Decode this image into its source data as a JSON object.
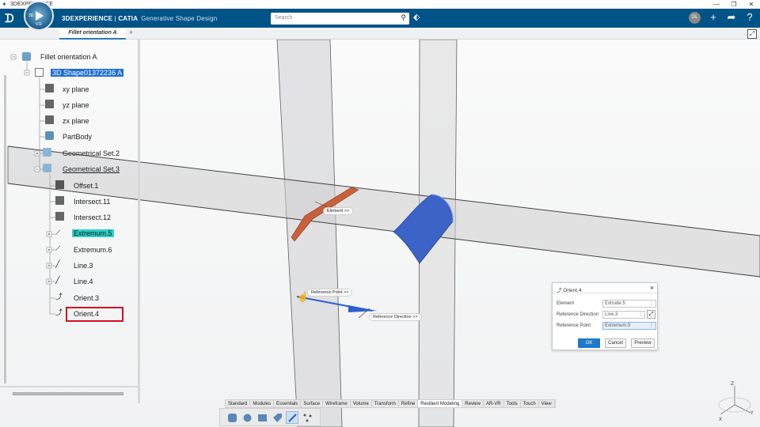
{
  "os_bar": {
    "title": "3DEXPERIENCE"
  },
  "header": {
    "brand": "3DEXPERIENCE",
    "product": "CATIA",
    "app": "Generative Shape Design",
    "compass_version": "V.R",
    "compass_label": "3D",
    "search_placeholder": "Search",
    "avatar_initials": "GL"
  },
  "tabs": [
    {
      "label": "Fillet orientation A"
    }
  ],
  "tree": {
    "root": "Fillet orientation A",
    "shape": "3D Shape01372236 A",
    "items": [
      {
        "label": "xy plane"
      },
      {
        "label": "yz plane"
      },
      {
        "label": "zx plane"
      },
      {
        "label": "PartBody"
      },
      {
        "label": "Geometrical Set.2"
      },
      {
        "label": "Geometrical Set.3"
      },
      {
        "label": "Offset.1"
      },
      {
        "label": "Intersect.11"
      },
      {
        "label": "Intersect.12"
      },
      {
        "label": "Extremum.5"
      },
      {
        "label": "Extremum.6"
      },
      {
        "label": "Line.3"
      },
      {
        "label": "Line.4"
      },
      {
        "label": "Orient.3"
      },
      {
        "label": "Orient.4"
      }
    ]
  },
  "viewport_labels": {
    "element": "Element >>",
    "reference_point": "Reference Point >>",
    "reference_direction": "Reference Direction >>"
  },
  "dialog": {
    "title": "Orient.4",
    "rows": [
      {
        "label": "Element",
        "value": "Extrude.5"
      },
      {
        "label": "Reference Direction",
        "value": "Line.3"
      },
      {
        "label": "Reference Point",
        "value": "Extremum.5"
      }
    ],
    "ok": "OK",
    "cancel": "Cancel",
    "preview": "Preview"
  },
  "ribbon_tabs": [
    "Standard",
    "Modules",
    "Essentials",
    "Surface",
    "Wireframe",
    "Volume",
    "Transform",
    "Refine",
    "Resilient Modeling",
    "Review",
    "AR-VR",
    "Tools",
    "Touch",
    "View"
  ],
  "ribbon_active": "Resilient Modeling",
  "axes": {
    "x": "X",
    "y": "Y",
    "z": "Z"
  },
  "colors": {
    "header": "#005386",
    "selection": "#1f6fd1",
    "highlight": "#2dd1c8",
    "callout": "#d10f1f",
    "surface_orange": "#c8603a",
    "surface_blue": "#3b63c8"
  }
}
